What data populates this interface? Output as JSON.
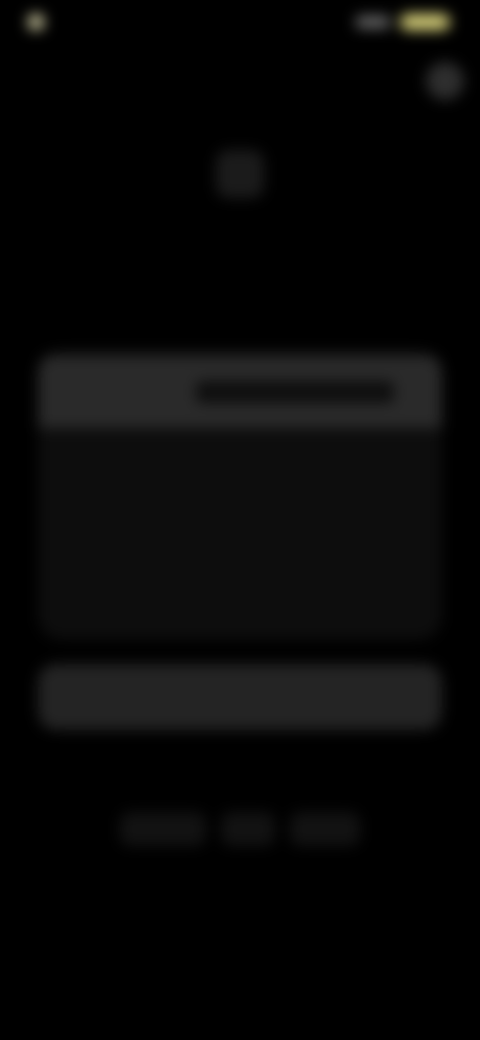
{
  "status_bar": {
    "time": "",
    "left_icon": "camera-dot",
    "right_icon": "battery-pill",
    "accent": "#d9d27b"
  },
  "header": {
    "close_icon": "close-icon",
    "app_icon": "app-logo",
    "title": "",
    "subtitle_line1": "",
    "subtitle_line2": ""
  },
  "plans": {
    "items": [
      {
        "label": "",
        "price": "",
        "selected": true
      },
      {
        "label": "",
        "price": "",
        "selected": false
      },
      {
        "label": "",
        "price": "",
        "selected": false
      },
      {
        "label": "",
        "price": "",
        "selected": false
      }
    ]
  },
  "actions": {
    "continue_label": "",
    "restore_label": ""
  },
  "footer": {
    "links": [
      {
        "label": ""
      },
      {
        "label": ""
      },
      {
        "label": ""
      }
    ]
  },
  "colors": {
    "background": "#000000",
    "card": "#0d0d0d",
    "selected_row": "#2a2a2a",
    "button": "#242424"
  }
}
